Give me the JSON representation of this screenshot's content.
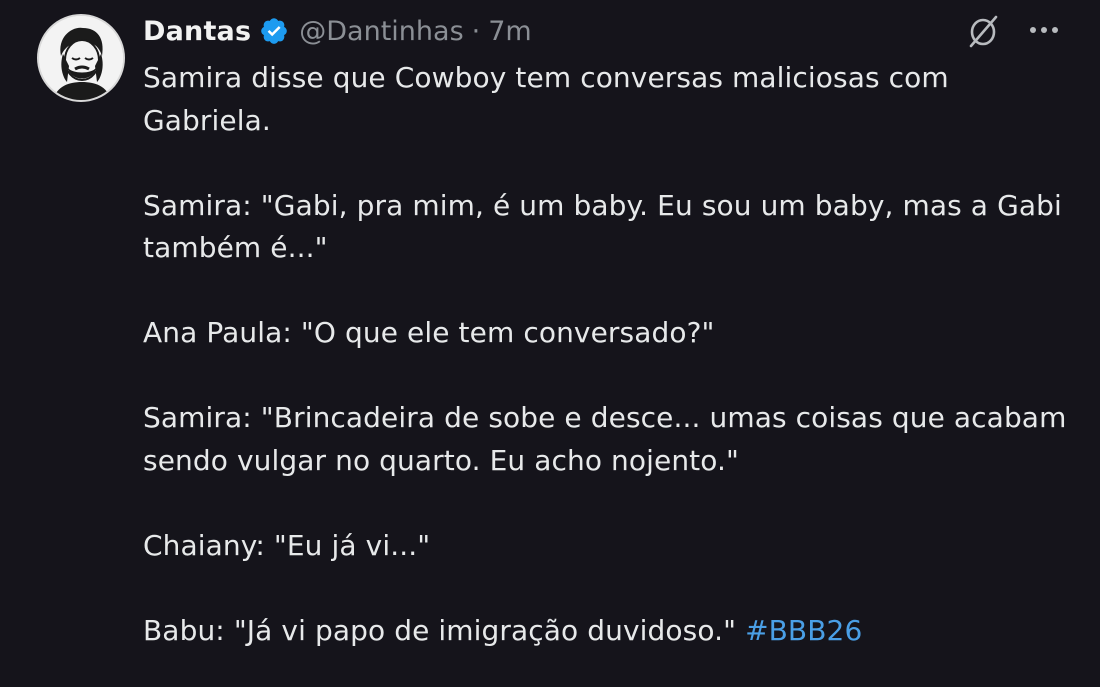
{
  "author": {
    "name": "Dantas",
    "handle": "@Dantinhas",
    "separator": "·",
    "time": "7m",
    "verified": true
  },
  "colors": {
    "background": "#15141b",
    "text": "#e7e9ea",
    "muted": "#8b8f95",
    "link": "#4a9fe6",
    "verified_badge": "#1d9bf0"
  },
  "icons": {
    "grok": "grok-slash-icon",
    "more": "more-horizontal-icon",
    "verified": "verified-badge-icon"
  },
  "tweet": {
    "lines": [
      "Samira disse que Cowboy tem conversas maliciosas com Gabriela.",
      "Samira: \"Gabi, pra mim, é um baby. Eu sou um baby, mas a Gabi também é...\"",
      "Ana Paula: \"O que ele tem conversado?\"",
      "Samira: \"Brincadeira de sobe e desce... umas coisas que acabam sendo vulgar no quarto. Eu acho nojento.\"",
      "Chaiany: \"Eu já vi...\"",
      "Babu: \"Já vi papo de imigração duvidoso.\""
    ],
    "hashtag": "#BBB26"
  }
}
